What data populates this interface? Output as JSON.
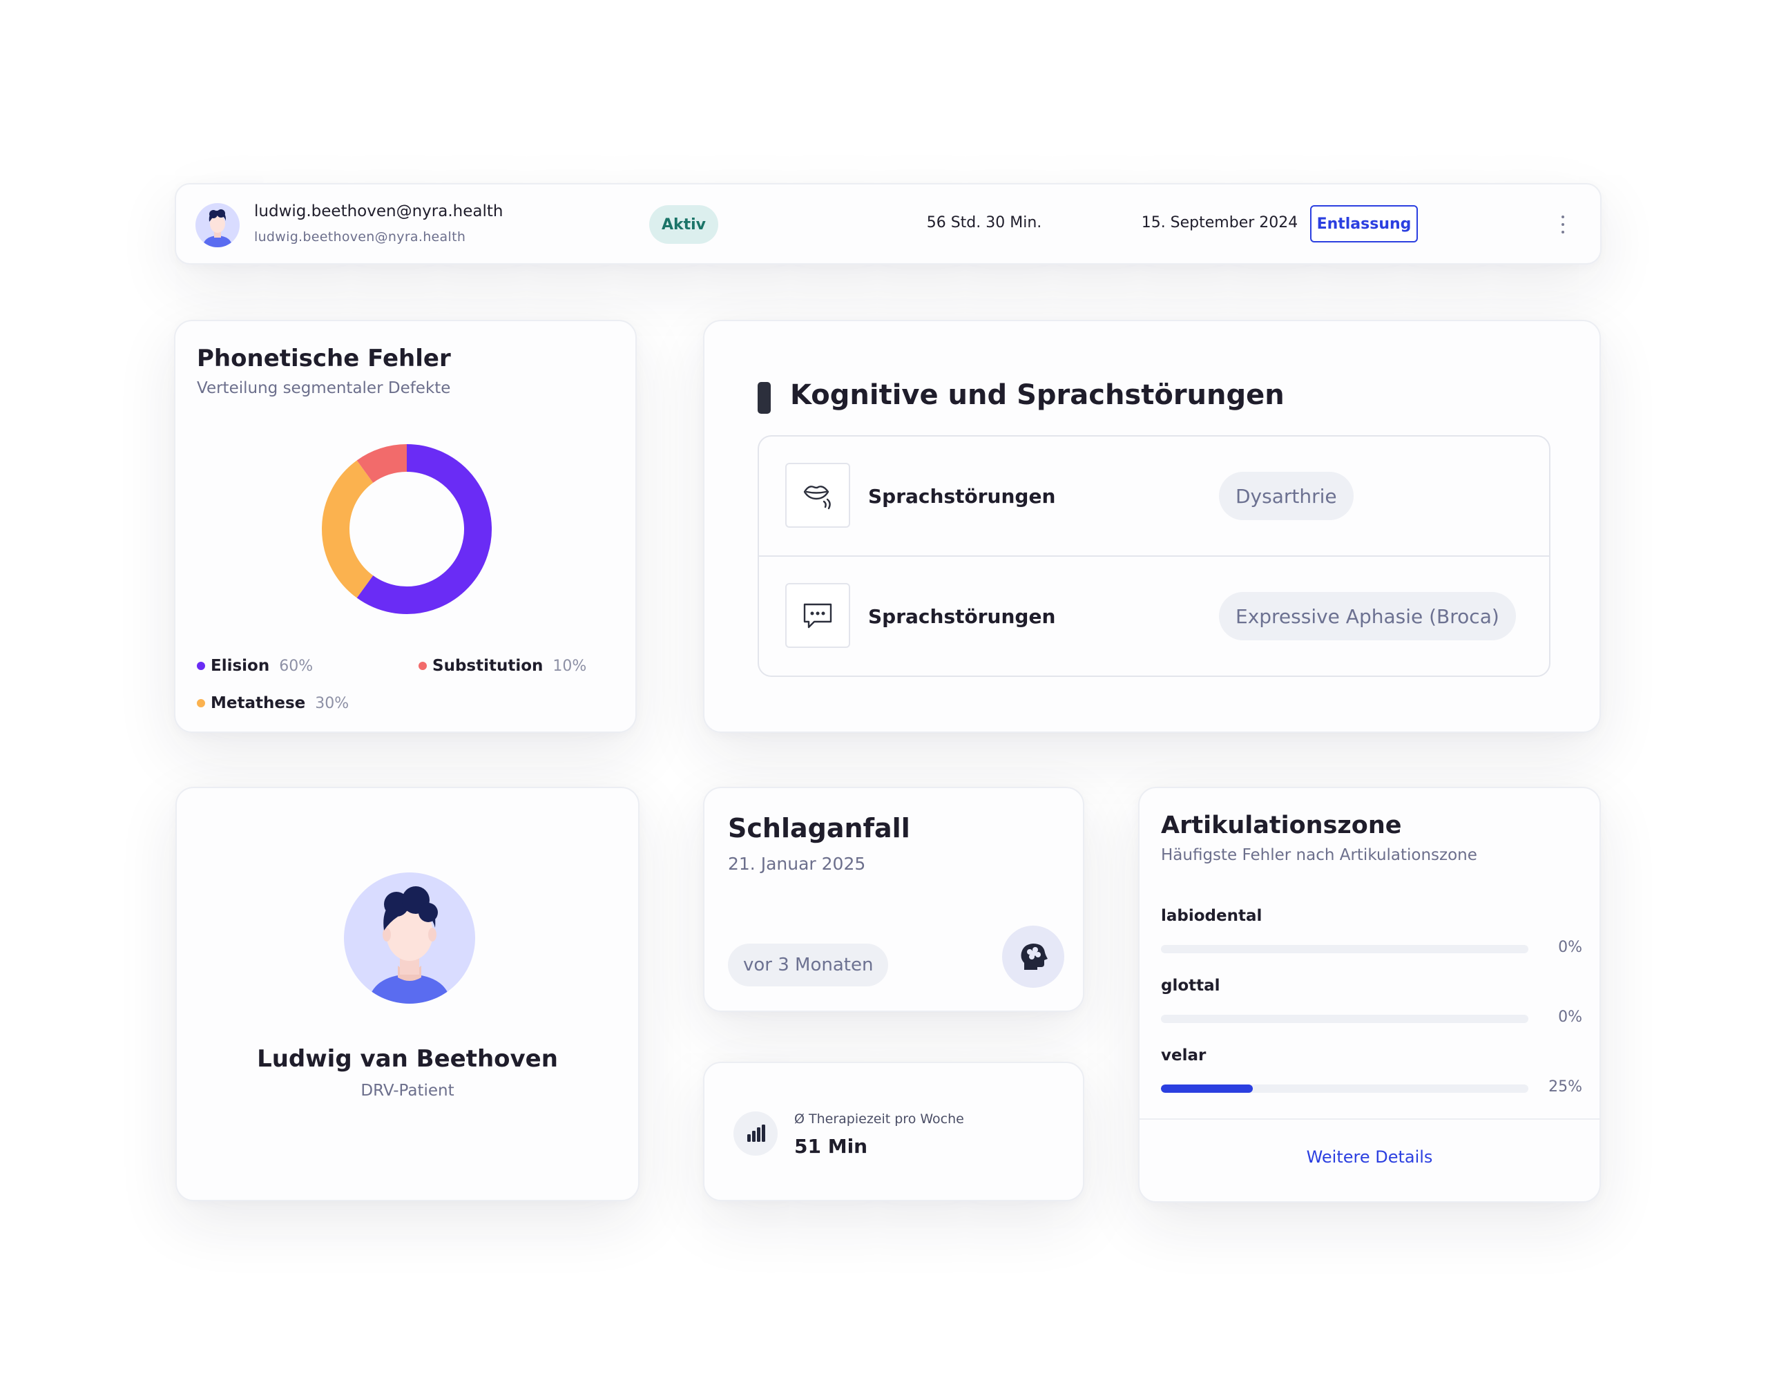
{
  "user_row": {
    "email_primary": "ludwig.beethoven@nyra.health",
    "email_secondary": "ludwig.beethoven@nyra.health",
    "status": "Aktiv",
    "duration": "56 Std. 30 Min.",
    "date": "15. September 2024",
    "action_label": "Entlassung",
    "more_icon": "more-vertical-icon"
  },
  "phonetic": {
    "title": "Phonetische Fehler",
    "subtitle": "Verteilung segmentaler Defekte",
    "legend": [
      {
        "label": "Elision",
        "value": "60%"
      },
      {
        "label": "Substitution",
        "value": "10%"
      },
      {
        "label": "Metathese",
        "value": "30%"
      }
    ]
  },
  "chart_data": {
    "type": "pie",
    "donut": true,
    "categories": [
      "Elision",
      "Substitution",
      "Metathese"
    ],
    "values": [
      60,
      10,
      30
    ],
    "colors": [
      "#6a2cf5",
      "#f26b6b",
      "#fbb24f"
    ],
    "title": "Phonetische Fehler",
    "subtitle": "Verteilung segmentaler Defekte",
    "legend_placement": "bottom"
  },
  "cognitive": {
    "title": "Kognitive und Sprachstörungen",
    "rows": [
      {
        "label": "Sprachstörungen",
        "tag": "Dysarthrie",
        "icon": "lips-icon"
      },
      {
        "label": "Sprachstörungen",
        "tag": "Expressive Aphasie (Broca)",
        "icon": "chat-bubble-icon"
      }
    ]
  },
  "patient": {
    "name": "Ludwig van Beethoven",
    "role": "DRV-Patient"
  },
  "stroke": {
    "title": "Schlaganfall",
    "date": "21. Januar 2025",
    "relative_time": "vor 3 Monaten",
    "icon": "brain-head-icon"
  },
  "therapy": {
    "label": "Ø Therapiezeit pro Woche",
    "value": "51 Min",
    "icon": "bar-chart-icon"
  },
  "articulation": {
    "title": "Artikulationszone",
    "subtitle": "Häufigste Fehler nach Artikulationszone",
    "items": [
      {
        "label": "labiodental",
        "value": "0%",
        "fraction": 0
      },
      {
        "label": "glottal",
        "value": "0%",
        "fraction": 0
      },
      {
        "label": "velar",
        "value": "25%",
        "fraction": 0.25
      }
    ],
    "link": "Weitere Details"
  },
  "colors": {
    "accent": "#2b3fe0",
    "status_bg": "#dcefee",
    "status_text": "#1b7468",
    "avatar_bg": "#d9dcff"
  }
}
